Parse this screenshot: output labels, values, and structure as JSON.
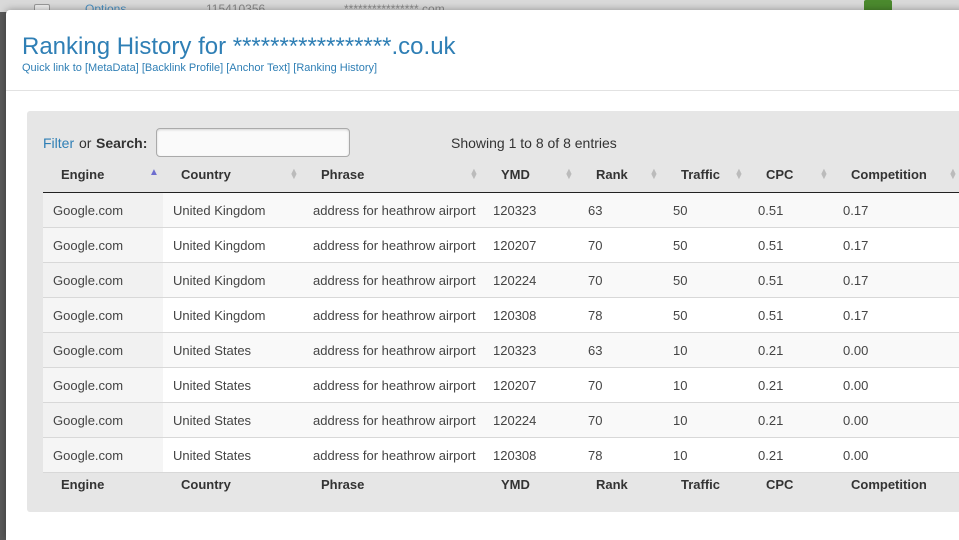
{
  "background": {
    "options_link": "Options",
    "number": "115410356",
    "domain": "****************.com"
  },
  "modal": {
    "title": "Ranking History for *****************.co.uk",
    "quick_links": {
      "prefix": "Quick link to",
      "items": [
        "[MetaData]",
        "[Backlink Profile]",
        "[Anchor Text]",
        "[Ranking History]"
      ]
    }
  },
  "filter": {
    "filter_link": "Filter",
    "or_text": "or",
    "search_label": "Search:",
    "search_value": ""
  },
  "info": "Showing 1 to 8 of 8 entries",
  "table": {
    "columns": [
      "Engine",
      "Country",
      "Phrase",
      "YMD",
      "Rank",
      "Traffic",
      "CPC",
      "Competition"
    ],
    "sorted_column": "Engine",
    "sort_direction": "asc",
    "rows": [
      [
        "Google.com",
        "United Kingdom",
        "address for heathrow airport",
        "120323",
        "63",
        "50",
        "0.51",
        "0.17"
      ],
      [
        "Google.com",
        "United Kingdom",
        "address for heathrow airport",
        "120207",
        "70",
        "50",
        "0.51",
        "0.17"
      ],
      [
        "Google.com",
        "United Kingdom",
        "address for heathrow airport",
        "120224",
        "70",
        "50",
        "0.51",
        "0.17"
      ],
      [
        "Google.com",
        "United Kingdom",
        "address for heathrow airport",
        "120308",
        "78",
        "50",
        "0.51",
        "0.17"
      ],
      [
        "Google.com",
        "United States",
        "address for heathrow airport",
        "120323",
        "63",
        "10",
        "0.21",
        "0.00"
      ],
      [
        "Google.com",
        "United States",
        "address for heathrow airport",
        "120207",
        "70",
        "10",
        "0.21",
        "0.00"
      ],
      [
        "Google.com",
        "United States",
        "address for heathrow airport",
        "120224",
        "70",
        "10",
        "0.21",
        "0.00"
      ],
      [
        "Google.com",
        "United States",
        "address for heathrow airport",
        "120308",
        "78",
        "10",
        "0.21",
        "0.00"
      ]
    ]
  },
  "colors": {
    "accent": "#2f7fb5",
    "panel_bg": "#e6e6e6",
    "sort_active": "#6e6ecf"
  },
  "icons": {
    "sort_asc": "sort-ascending-icon",
    "sort_both": "sort-both-icon"
  }
}
